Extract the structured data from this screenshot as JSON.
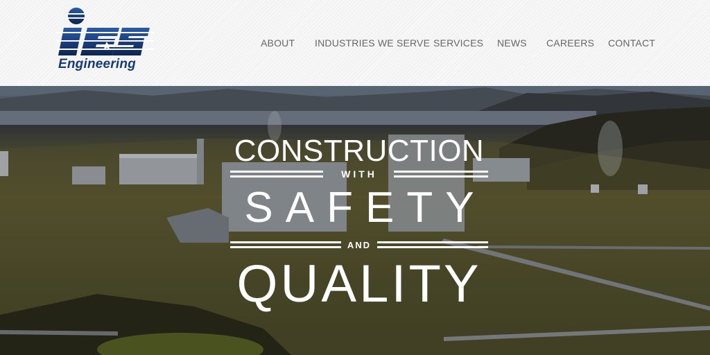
{
  "logo": {
    "letters": "IES",
    "wordmark": "Engineering",
    "colors": {
      "primary": "#153a78",
      "dark": "#0c2450"
    }
  },
  "nav": {
    "items": [
      {
        "label": "ABOUT"
      },
      {
        "label": "INDUSTRIES WE SERVE"
      },
      {
        "label": "SERVICES"
      },
      {
        "label": "NEWS"
      },
      {
        "label": "CAREERS"
      },
      {
        "label": "CONTACT"
      }
    ]
  },
  "hero": {
    "line1": "CONSTRUCTION",
    "line2": "WITH",
    "line3": "SAFETY",
    "line4": "AND",
    "line5": "QUALITY",
    "image_desc": "geothermal power plant",
    "text_color": "#ffffff"
  }
}
